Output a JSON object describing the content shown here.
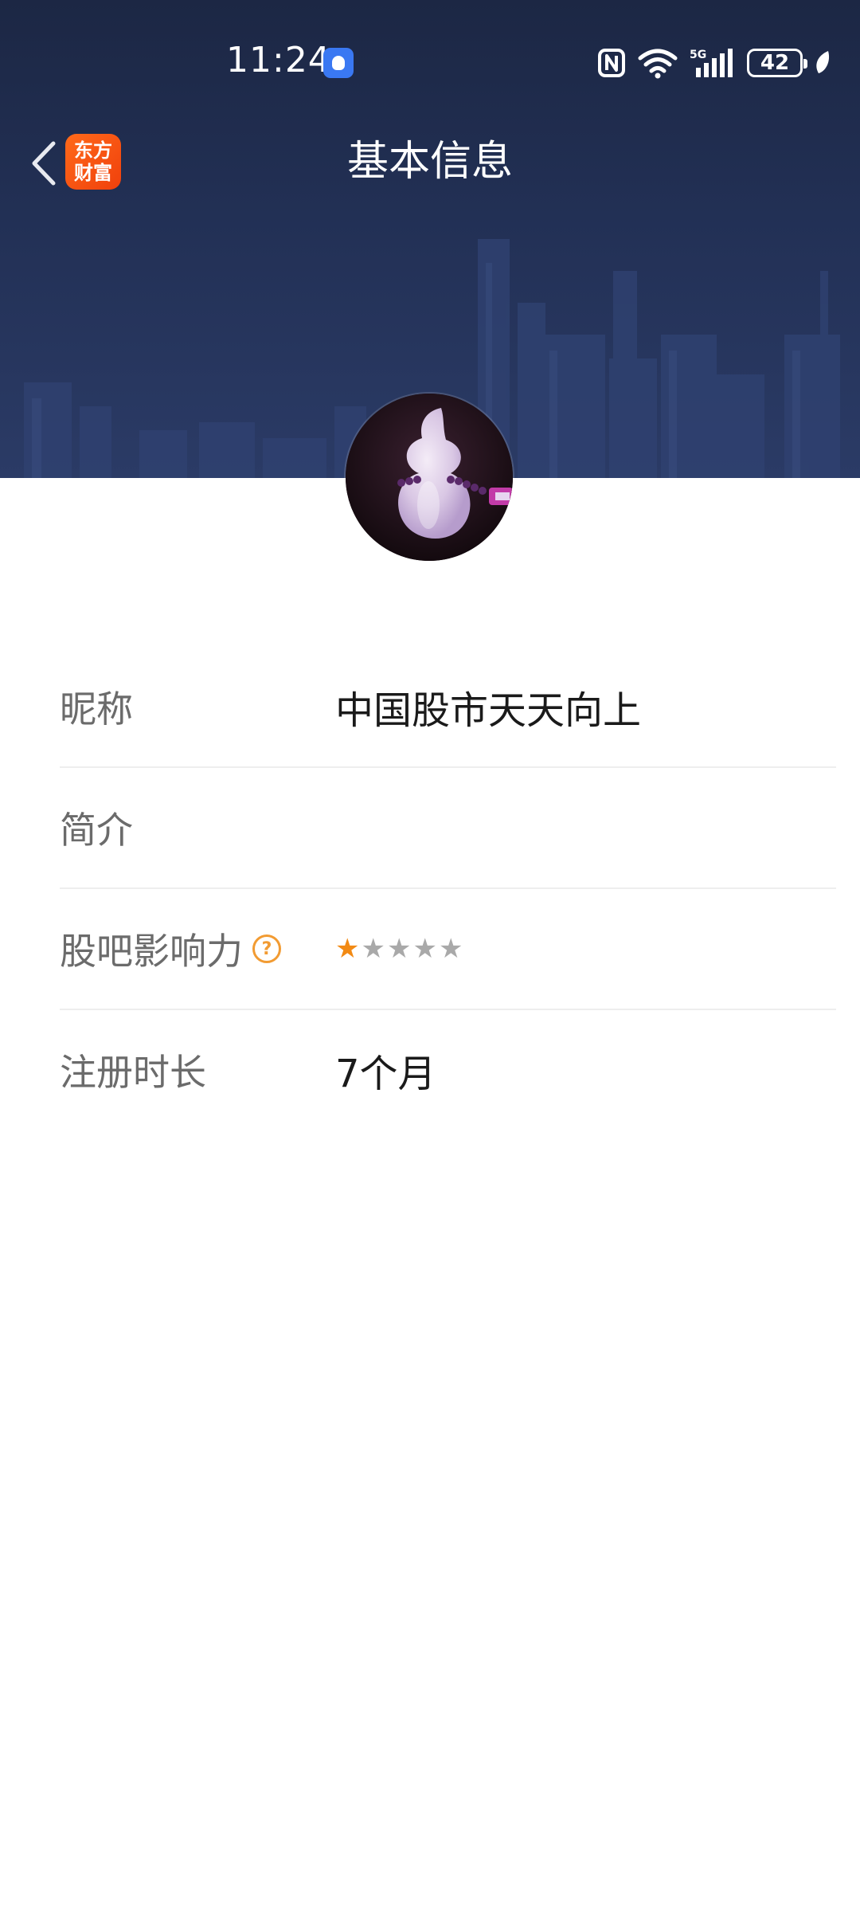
{
  "status_bar": {
    "time": "11:24",
    "battery": "42"
  },
  "nav": {
    "title": "基本信息",
    "logo_line1": "东方",
    "logo_line2": "财富"
  },
  "profile": {
    "rows": [
      {
        "label": "昵称",
        "value": "中国股市天天向上"
      },
      {
        "label": "简介",
        "value": ""
      },
      {
        "label": "股吧影响力",
        "help": "?",
        "rating": 1,
        "rating_max": 5
      },
      {
        "label": "注册时长",
        "value": "7个月"
      }
    ]
  },
  "colors": {
    "header_bg": "#1f2b4d",
    "logo": "#f0400c",
    "accent": "#f28a14"
  }
}
